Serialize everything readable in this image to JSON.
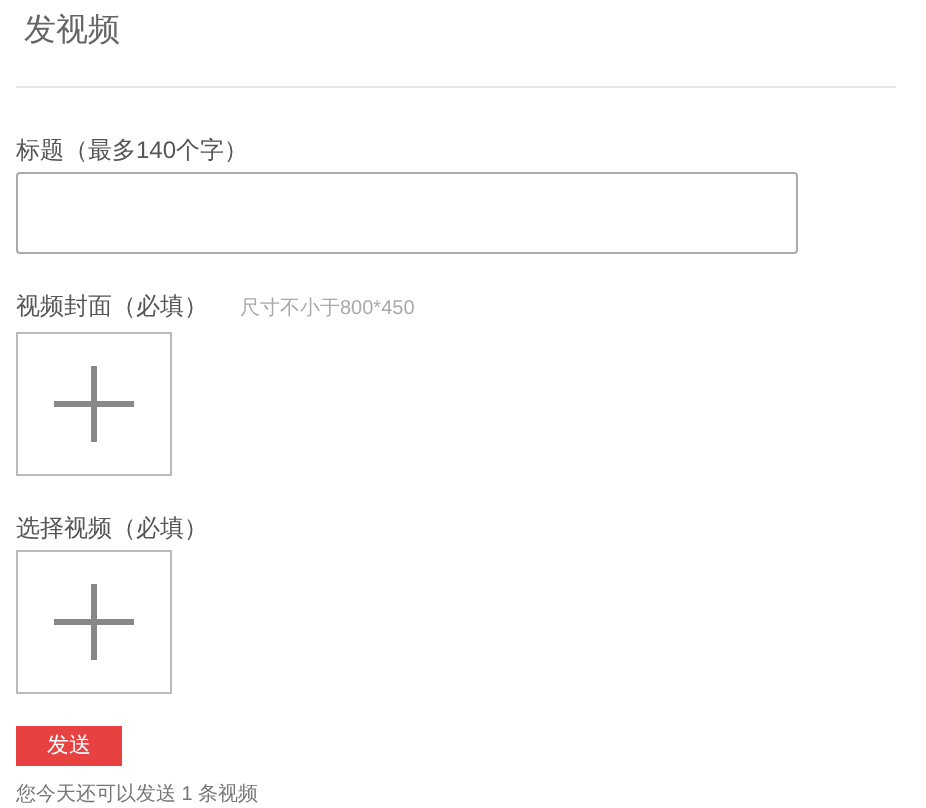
{
  "page_title": "发视频",
  "title_field": {
    "label": "标题（最多140个字）"
  },
  "cover_upload": {
    "label": "视频封面（必填）",
    "hint": "尺寸不小于800*450"
  },
  "video_upload": {
    "label": "选择视频（必填）"
  },
  "submit_button": "发送",
  "quota_note": "您今天还可以发送 1 条视频"
}
